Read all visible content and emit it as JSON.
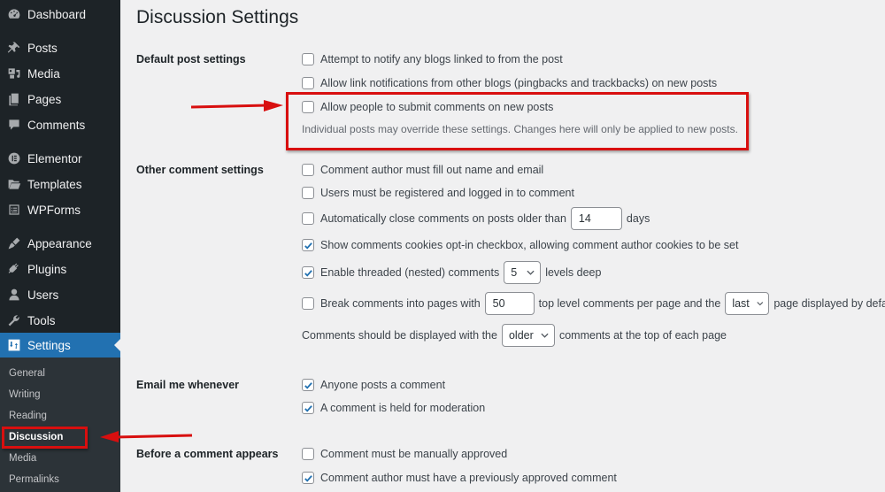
{
  "sidebar": {
    "items": [
      {
        "label": "Dashboard",
        "icon": "dashboard-icon"
      },
      {
        "label": "Posts",
        "icon": "pin-icon"
      },
      {
        "label": "Media",
        "icon": "media-icon"
      },
      {
        "label": "Pages",
        "icon": "pages-icon"
      },
      {
        "label": "Comments",
        "icon": "comment-icon"
      },
      {
        "label": "Elementor",
        "icon": "elementor-icon"
      },
      {
        "label": "Templates",
        "icon": "folder-icon"
      },
      {
        "label": "WPForms",
        "icon": "forms-icon"
      },
      {
        "label": "Appearance",
        "icon": "brush-icon"
      },
      {
        "label": "Plugins",
        "icon": "plug-icon"
      },
      {
        "label": "Users",
        "icon": "user-icon"
      },
      {
        "label": "Tools",
        "icon": "wrench-icon"
      },
      {
        "label": "Settings",
        "icon": "settings-icon",
        "active": true
      }
    ],
    "submenu": [
      {
        "label": "General"
      },
      {
        "label": "Writing"
      },
      {
        "label": "Reading"
      },
      {
        "label": "Discussion",
        "current": true
      },
      {
        "label": "Media"
      },
      {
        "label": "Permalinks"
      }
    ]
  },
  "page": {
    "title": "Discussion Settings"
  },
  "sections": {
    "default_post": {
      "label": "Default post settings",
      "options": [
        {
          "label": "Attempt to notify any blogs linked to from the post",
          "checked": false
        },
        {
          "label": "Allow link notifications from other blogs (pingbacks and trackbacks) on new posts",
          "checked": false
        },
        {
          "label": "Allow people to submit comments on new posts",
          "checked": false
        }
      ],
      "description": "Individual posts may override these settings. Changes here will only be applied to new posts."
    },
    "other_comment": {
      "label": "Other comment settings",
      "name_email": {
        "label": "Comment author must fill out name and email",
        "checked": false
      },
      "registered": {
        "label": "Users must be registered and logged in to comment",
        "checked": false
      },
      "auto_close": {
        "label": "Automatically close comments on posts older than",
        "checked": false,
        "value": "14",
        "suffix": "days"
      },
      "cookies": {
        "label": "Show comments cookies opt-in checkbox, allowing comment author cookies to be set",
        "checked": true
      },
      "threaded": {
        "label": "Enable threaded (nested) comments",
        "checked": true,
        "value": "5",
        "suffix": "levels deep"
      },
      "paged": {
        "label": "Break comments into pages with",
        "checked": false,
        "value": "50",
        "middle": "top level comments per page and the",
        "select_value": "last",
        "suffix": "page displayed by default"
      },
      "order": {
        "prefix": "Comments should be displayed with the",
        "select_value": "older",
        "suffix": "comments at the top of each page"
      }
    },
    "email": {
      "label": "Email me whenever",
      "options": [
        {
          "label": "Anyone posts a comment",
          "checked": true
        },
        {
          "label": "A comment is held for moderation",
          "checked": true
        }
      ]
    },
    "before_appears": {
      "label": "Before a comment appears",
      "options": [
        {
          "label": "Comment must be manually approved",
          "checked": false
        },
        {
          "label": "Comment author must have a previously approved comment",
          "checked": true
        }
      ]
    }
  },
  "annotation_color": "#d80f0f"
}
